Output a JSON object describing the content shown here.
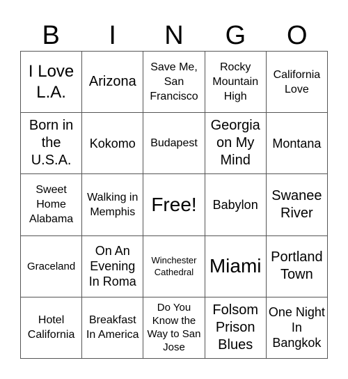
{
  "header": [
    "B",
    "I",
    "N",
    "G",
    "O"
  ],
  "cells": [
    {
      "text": "I Love L.A.",
      "size": "s24"
    },
    {
      "text": "Arizona",
      "size": "s20"
    },
    {
      "text": "Save Me, San Francisco",
      "size": "s16"
    },
    {
      "text": "Rocky Mountain High",
      "size": "s16"
    },
    {
      "text": "California Love",
      "size": "s16"
    },
    {
      "text": "Born in the U.S.A.",
      "size": "s20"
    },
    {
      "text": "Kokomo",
      "size": "s18"
    },
    {
      "text": "Budapest",
      "size": "s16"
    },
    {
      "text": "Georgia on My Mind",
      "size": "s20"
    },
    {
      "text": "Montana",
      "size": "s18"
    },
    {
      "text": "Sweet Home Alabama",
      "size": "s16"
    },
    {
      "text": "Walking in Memphis",
      "size": "s16"
    },
    {
      "text": "Free!",
      "size": "s28"
    },
    {
      "text": "Babylon",
      "size": "s18"
    },
    {
      "text": "Swanee River",
      "size": "s20"
    },
    {
      "text": "Graceland",
      "size": "s15"
    },
    {
      "text": "On An Evening In Roma",
      "size": "s18"
    },
    {
      "text": "Winchester Cathedral",
      "size": "s13"
    },
    {
      "text": "Miami",
      "size": "s28"
    },
    {
      "text": "Portland Town",
      "size": "s20"
    },
    {
      "text": "Hotel California",
      "size": "s16"
    },
    {
      "text": "Breakfast In America",
      "size": "s16"
    },
    {
      "text": "Do You Know the Way to San Jose",
      "size": "s15"
    },
    {
      "text": "Folsom Prison Blues",
      "size": "s20"
    },
    {
      "text": "One Night In Bangkok",
      "size": "s18"
    }
  ]
}
